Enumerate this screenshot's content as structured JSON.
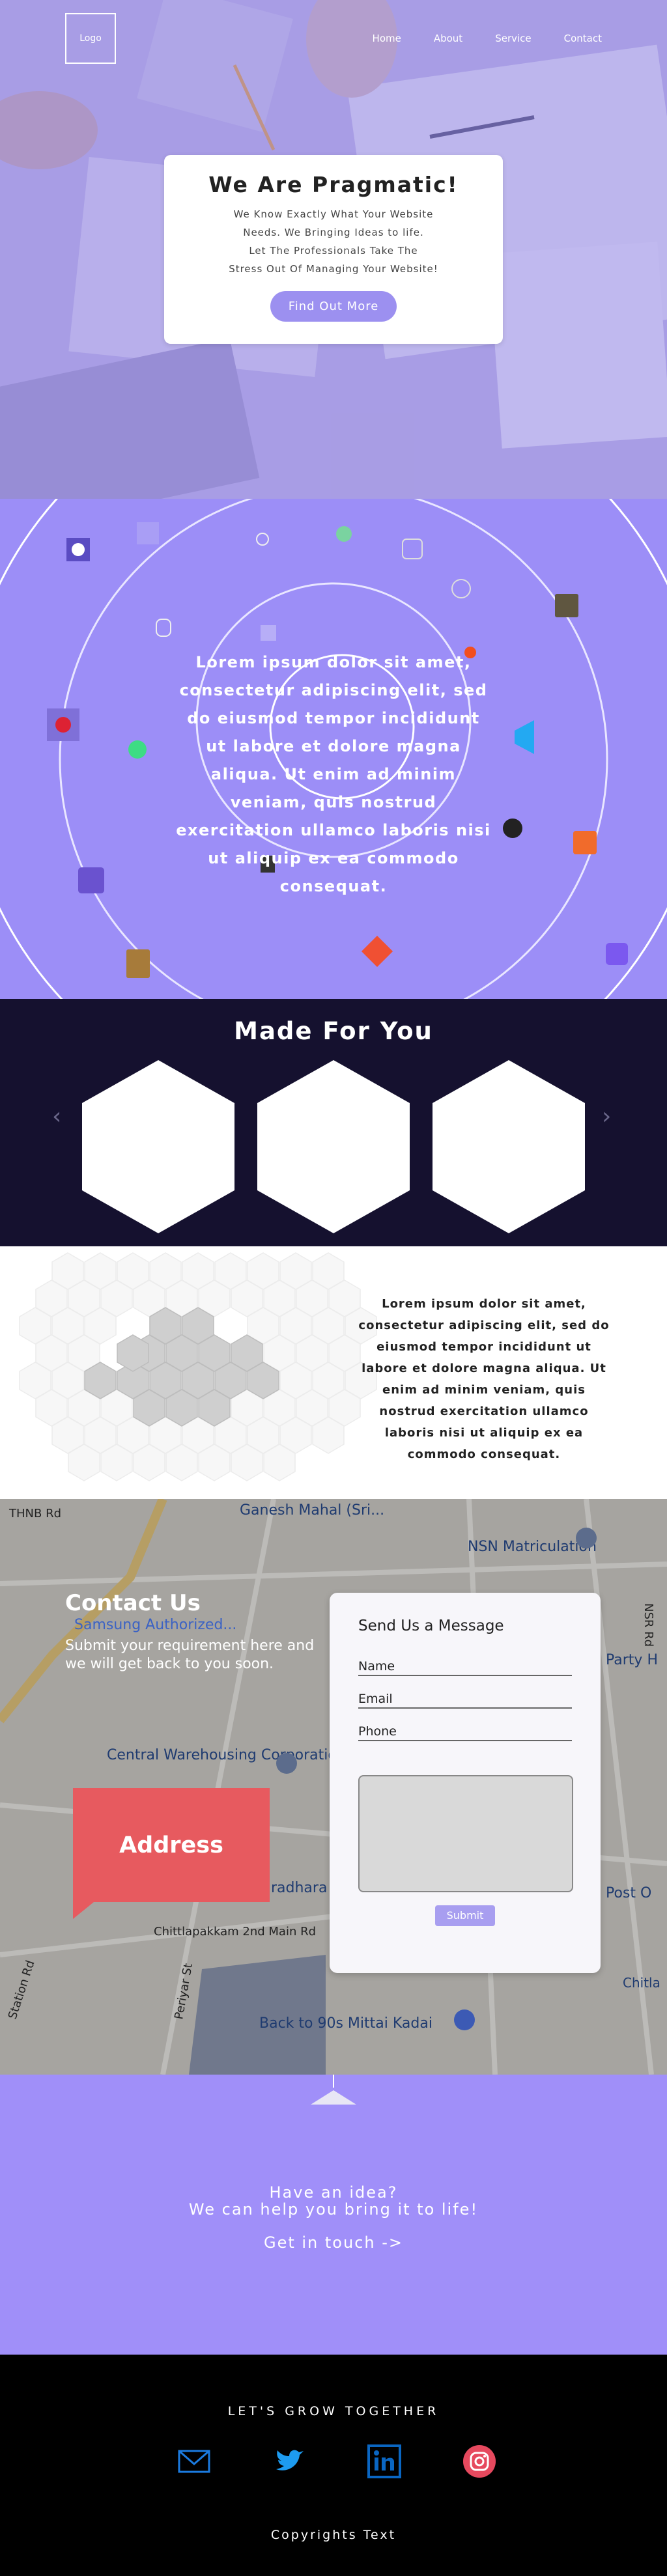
{
  "header": {
    "logo": "Logo",
    "nav": [
      {
        "label": "Home"
      },
      {
        "label": "About"
      },
      {
        "label": "Service"
      },
      {
        "label": "Contact"
      }
    ]
  },
  "hero": {
    "title": "We Are Pragmatic!",
    "lines": [
      "We Know Exactly What Your Website",
      "Needs. We Bringing Ideas to life.",
      "Let The Professionals Take The",
      "Stress Out Of Managing Your Website!"
    ],
    "cta": "Find Out More"
  },
  "orbit": {
    "text": "Lorem ipsum dolor sit amet, consectetur adipiscing elit, sed do eiusmod tempor incididunt ut labore et dolore magna aliqua. Ut enim ad minim veniam, quis nostrud exercitation ullamco laboris nisi ut aliquip ex ea commodo consequat.",
    "icons": [
      "code-icon",
      "user-icon",
      "database-icon",
      "figma-icon",
      "vscode-icon",
      "git-icon",
      "java-icon",
      "github-icon",
      "android-icon",
      "docker-icon",
      "discord-icon",
      "flutter-icon"
    ]
  },
  "made_for_you": {
    "title": "Made For You",
    "prev": "‹",
    "next": "›"
  },
  "about": {
    "text": "Lorem ipsum dolor sit amet, consectetur adipiscing elit, sed do eiusmod tempor incididunt ut labore et dolore magna aliqua. Ut enim ad minim veniam, quis nostrud exercitation ullamco laboris nisi ut aliquip ex ea commodo consequat."
  },
  "contact": {
    "title": "Contact Us",
    "subtitle": "Submit your requirement here and we will get back to you soon.",
    "address_label": "Address",
    "map_labels": [
      "Ganesh Mahal (Sri...",
      "NSN Matriculation",
      "Central Warehousing Corporation",
      "Chittlapakkam 2nd Main Rd",
      "Back to 90s Mittai Kadai",
      "Samsung Authorized...",
      "Station Rd",
      "Periyar St",
      "Post O",
      "Party H",
      "radhara",
      "Chitla",
      "NSR Rd",
      "THNB Rd"
    ],
    "form": {
      "heading": "Send Us a Message",
      "fields": [
        "Name",
        "Email",
        "Phone"
      ],
      "submit": "Submit"
    }
  },
  "idea": {
    "line1": "Have an idea?",
    "line2": "We can help you bring it to life!",
    "cta": "Get in touch ->"
  },
  "footer": {
    "tagline": "LET'S GROW TOGETHER",
    "social": [
      "mail-icon",
      "twitter-icon",
      "linkedin-icon",
      "instagram-icon"
    ],
    "copyright": "Copyrights Text"
  }
}
